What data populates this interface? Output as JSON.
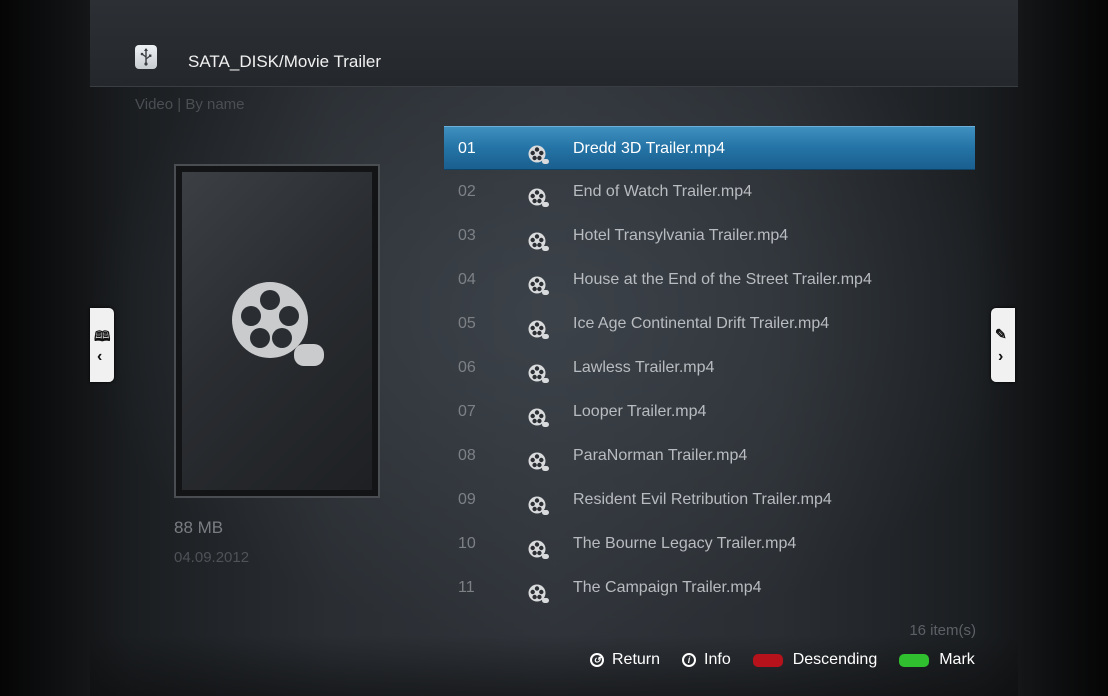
{
  "header": {
    "path": "SATA_DISK/Movie Trailer",
    "view_mode": "Video | By name",
    "icon": "usb-icon"
  },
  "preview": {
    "icon": "film-reel-icon",
    "size": "88 MB",
    "date": "04.09.2012"
  },
  "files": [
    {
      "num": "01",
      "name": "Dredd 3D Trailer.mp4",
      "selected": true
    },
    {
      "num": "02",
      "name": "End of Watch Trailer.mp4"
    },
    {
      "num": "03",
      "name": "Hotel Transylvania Trailer.mp4"
    },
    {
      "num": "04",
      "name": "House at the End of the Street Trailer.mp4"
    },
    {
      "num": "05",
      "name": "Ice Age Continental Drift Trailer.mp4"
    },
    {
      "num": "06",
      "name": "Lawless Trailer.mp4"
    },
    {
      "num": "07",
      "name": "Looper Trailer.mp4"
    },
    {
      "num": "08",
      "name": "ParaNorman Trailer.mp4"
    },
    {
      "num": "09",
      "name": "Resident Evil Retribution Trailer.mp4"
    },
    {
      "num": "10",
      "name": "The Bourne Legacy Trailer.mp4"
    },
    {
      "num": "11",
      "name": "The Campaign Trailer.mp4"
    }
  ],
  "item_count": "16 item(s)",
  "legend": {
    "return_label": "Return",
    "info_label": "Info",
    "descending_label": "Descending",
    "mark_label": "Mark",
    "red_color": "#b5121b",
    "green_color": "#2fbf2f"
  },
  "side_tabs": {
    "left_icon": "book-icon",
    "right_icon": "edit-icon"
  },
  "colors": {
    "selection": "#2473a6"
  }
}
